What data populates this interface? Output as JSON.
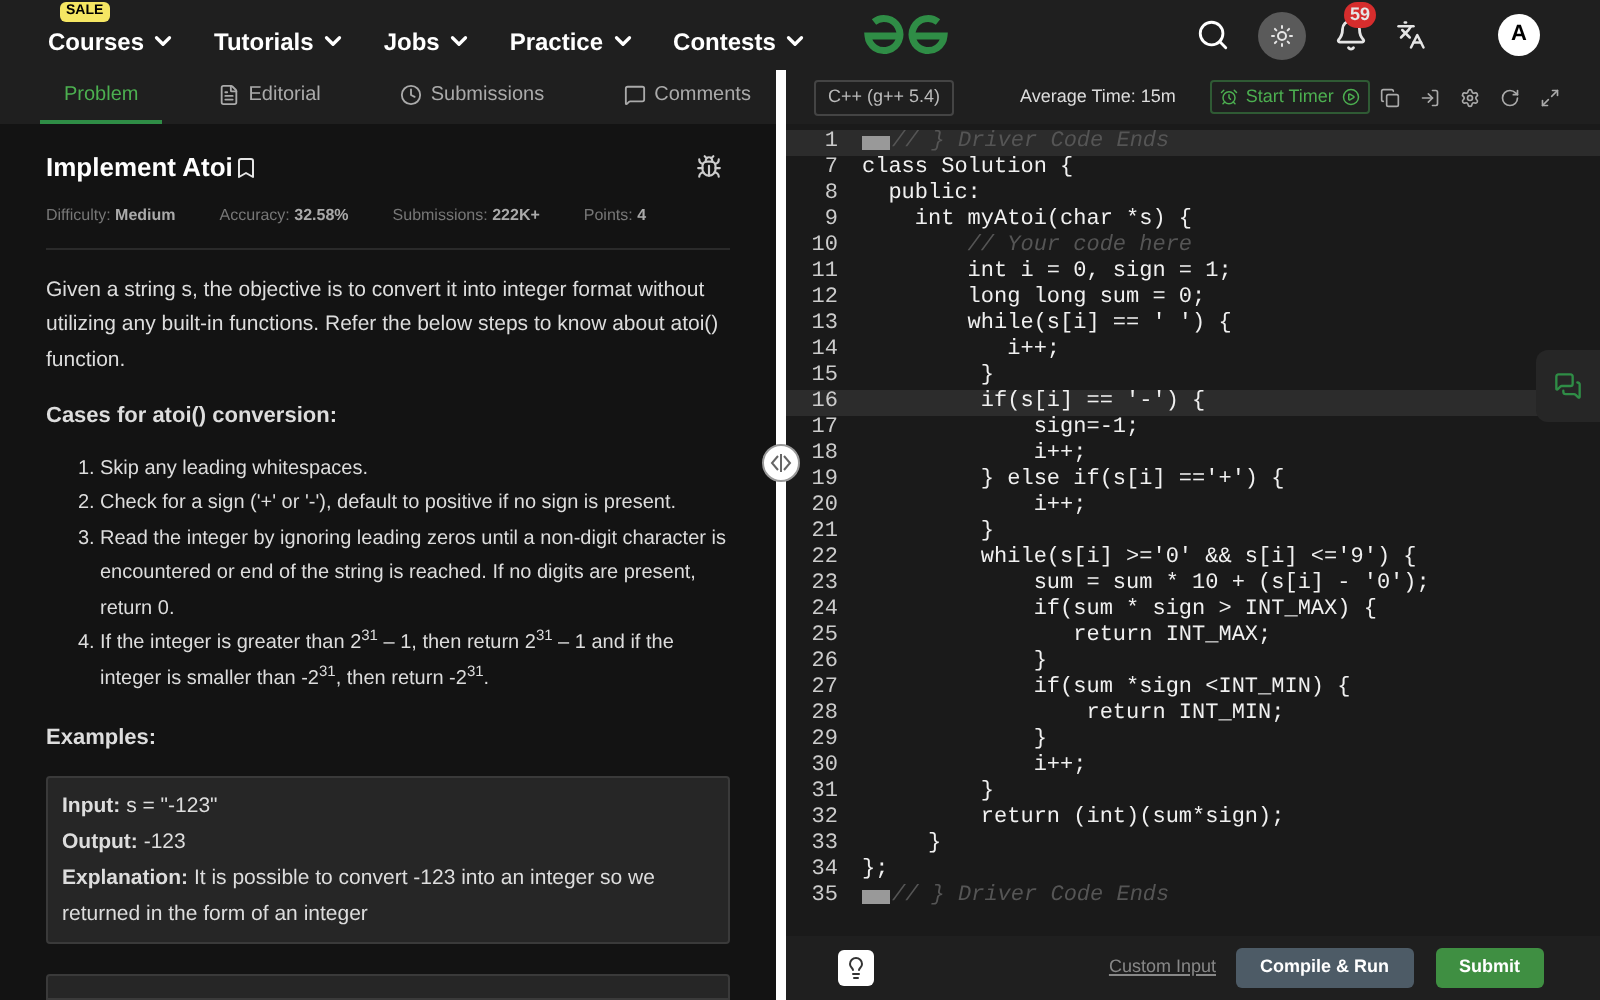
{
  "nav": {
    "items": [
      {
        "label": "Courses",
        "badge": "SALE"
      },
      {
        "label": "Tutorials"
      },
      {
        "label": "Jobs"
      },
      {
        "label": "Practice"
      },
      {
        "label": "Contests"
      }
    ],
    "notifications": "59",
    "avatar": "A"
  },
  "tabs": [
    {
      "label": "Problem",
      "selected": true
    },
    {
      "label": "Editorial",
      "selected": false
    },
    {
      "label": "Submissions",
      "selected": false
    },
    {
      "label": "Comments",
      "selected": false
    }
  ],
  "problem": {
    "title": "Implement Atoi",
    "meta": [
      {
        "label": "Difficulty:",
        "value": "Medium"
      },
      {
        "label": "Accuracy:",
        "value": "32.58%"
      },
      {
        "label": "Submissions:",
        "value": "222K+"
      },
      {
        "label": "Points:",
        "value": "4"
      }
    ],
    "description": "Given a string s, the objective is to convert it into integer format without utilizing any built-in functions. Refer the below steps to know about atoi() function.",
    "cases_heading": "Cases for atoi() conversion:",
    "steps": [
      {
        "num": "1.",
        "text": "Skip any leading whitespaces."
      },
      {
        "num": "2.",
        "text": "Check for a sign ('+' or '-'), default to positive if no sign is present."
      },
      {
        "num": "3.",
        "text": "Read the integer by ignoring leading zeros until a non-digit character is encountered or end of the string is reached. If no digits are present, return 0."
      },
      {
        "num": "4.",
        "text": "If the integer is greater than 2$^{31}$ – 1, then return 2$^{31}$ – 1 and if the integer is smaller than -2$^{31}$, then return -2$^{31}$."
      }
    ],
    "examples_heading": "Examples:",
    "example": [
      {
        "label": "Input:",
        "value": "s = \"-123\""
      },
      {
        "label": "Output:",
        "value": "-123"
      },
      {
        "label": "Explanation:",
        "value": "It is possible to convert -123 into an integer so we returned in the form of an integer"
      }
    ]
  },
  "editor": {
    "language": "C++ (g++ 5.4)",
    "average_time": "Average Time: 15m",
    "timer": "Start Timer",
    "lines": [
      {
        "num": "1",
        "kind": "fold",
        "text": "// } Driver Code Ends",
        "highlighted": true
      },
      {
        "num": "7",
        "kind": "code",
        "text": "class Solution {",
        "highlighted": false
      },
      {
        "num": "8",
        "kind": "code",
        "text": "  public:",
        "highlighted": false
      },
      {
        "num": "9",
        "kind": "code",
        "text": "    int myAtoi(char *s) {",
        "highlighted": false
      },
      {
        "num": "10",
        "kind": "comment",
        "text": "        // Your code here",
        "highlighted": false
      },
      {
        "num": "11",
        "kind": "code",
        "text": "        int i = 0, sign = 1;",
        "highlighted": false
      },
      {
        "num": "12",
        "kind": "code",
        "text": "        long long sum = 0;",
        "highlighted": false
      },
      {
        "num": "13",
        "kind": "code",
        "text": "        while(s[i] == ' ') {",
        "highlighted": false
      },
      {
        "num": "14",
        "kind": "code",
        "text": "           i++;",
        "highlighted": false
      },
      {
        "num": "15",
        "kind": "code",
        "text": "         }",
        "highlighted": false
      },
      {
        "num": "16",
        "kind": "code",
        "text": "         if(s[i] == '-') {",
        "highlighted": true
      },
      {
        "num": "17",
        "kind": "code",
        "text": "             sign=-1;",
        "highlighted": false
      },
      {
        "num": "18",
        "kind": "code",
        "text": "             i++;",
        "highlighted": false
      },
      {
        "num": "19",
        "kind": "code",
        "text": "         } else if(s[i] =='+') {",
        "highlighted": false
      },
      {
        "num": "20",
        "kind": "code",
        "text": "             i++;",
        "highlighted": false
      },
      {
        "num": "21",
        "kind": "code",
        "text": "         }",
        "highlighted": false
      },
      {
        "num": "22",
        "kind": "code",
        "text": "         while(s[i] >='0' && s[i] <='9') {",
        "highlighted": false
      },
      {
        "num": "23",
        "kind": "code",
        "text": "             sum = sum * 10 + (s[i] - '0');",
        "highlighted": false
      },
      {
        "num": "24",
        "kind": "code",
        "text": "             if(sum * sign > INT_MAX) {",
        "highlighted": false
      },
      {
        "num": "25",
        "kind": "code",
        "text": "                return INT_MAX;",
        "highlighted": false
      },
      {
        "num": "26",
        "kind": "code",
        "text": "             }",
        "highlighted": false
      },
      {
        "num": "27",
        "kind": "code",
        "text": "             if(sum *sign <INT_MIN) {",
        "highlighted": false
      },
      {
        "num": "28",
        "kind": "code",
        "text": "                 return INT_MIN;",
        "highlighted": false
      },
      {
        "num": "29",
        "kind": "code",
        "text": "             }",
        "highlighted": false
      },
      {
        "num": "30",
        "kind": "code",
        "text": "             i++;",
        "highlighted": false
      },
      {
        "num": "31",
        "kind": "code",
        "text": "         }",
        "highlighted": false
      },
      {
        "num": "32",
        "kind": "code",
        "text": "         return (int)(sum*sign);",
        "highlighted": false
      },
      {
        "num": "33",
        "kind": "code",
        "text": "     }",
        "highlighted": false
      },
      {
        "num": "34",
        "kind": "code",
        "text": "};",
        "highlighted": false
      },
      {
        "num": "35",
        "kind": "fold",
        "text": "// } Driver Code Ends",
        "highlighted": false
      }
    ],
    "custom_input": "Custom Input",
    "compile": "Compile & Run",
    "submit": "Submit"
  }
}
